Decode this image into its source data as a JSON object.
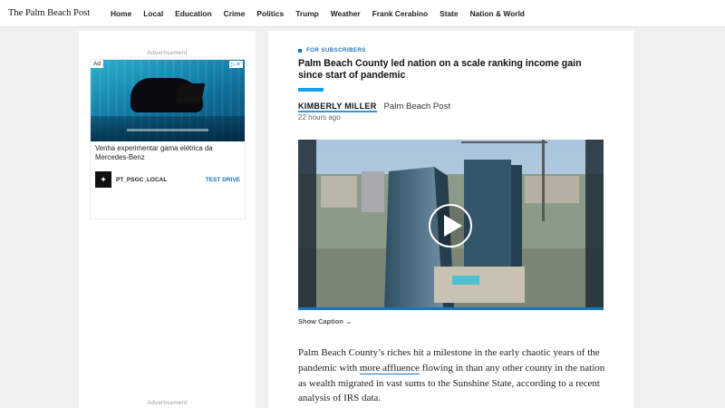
{
  "site": {
    "logo": "The Palm Beach Post"
  },
  "nav": {
    "items": [
      {
        "label": "Home"
      },
      {
        "label": "Local"
      },
      {
        "label": "Education"
      },
      {
        "label": "Crime"
      },
      {
        "label": "Politics"
      },
      {
        "label": "Trump"
      },
      {
        "label": "Weather"
      },
      {
        "label": "Frank Cerabino"
      },
      {
        "label": "State"
      },
      {
        "label": "Nation & World"
      }
    ]
  },
  "rail": {
    "ad_label_top": "Advertisement",
    "ad_label_bottom": "Advertisement",
    "ad": {
      "badge": "Ad",
      "text": "Venha experimentar gama elétrica da Mercedes-Benz",
      "source": "PT_PSGC_LOCAL",
      "cta": "TEST DRIVE"
    }
  },
  "article": {
    "kicker": "FOR SUBSCRIBERS",
    "headline": "Palm Beach County led nation on a scale ranking income gain since start of pandemic",
    "author": "KIMBERLY MILLER",
    "source": "Palm Beach Post",
    "timestamp": "22 hours ago",
    "show_caption": "Show Caption",
    "body_before_link": "Palm Beach County’s riches hit a milestone in the early chaotic years of the pandemic with ",
    "body_link": "more affluence",
    "body_after_link": " flowing in than any other county in the nation as wealth migrated in vast sums to the Sunshine State, according to a recent analysis of IRS data."
  },
  "colors": {
    "accent": "#1b75bc",
    "accent_bar": "#1b9fe8"
  },
  "icons": {
    "play": "play-icon",
    "chevron": "chevron-down-icon",
    "ad_logo": "mercedes-star-icon"
  }
}
